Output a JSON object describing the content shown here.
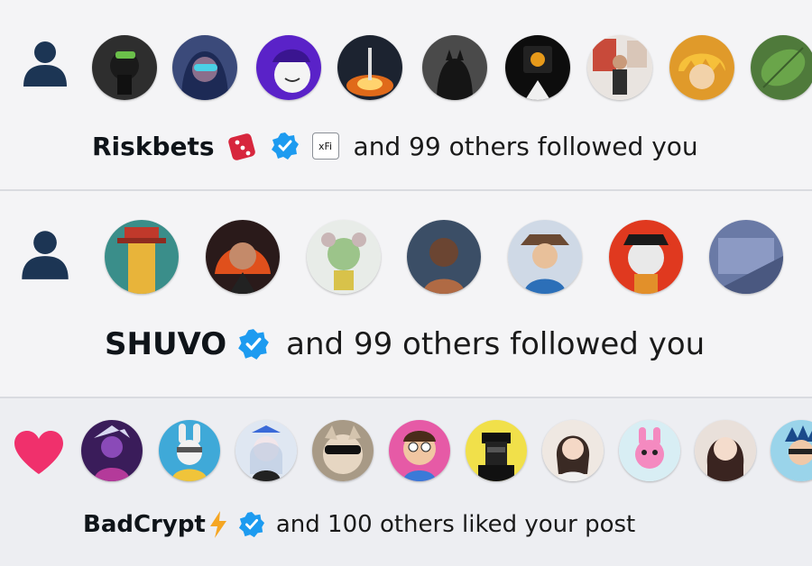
{
  "notifications": [
    {
      "type": "follow",
      "name": "Riskbets",
      "badges": [
        "dice-icon",
        "verified-badge-icon",
        "xfi-badge"
      ],
      "xfi_label": "xFi",
      "message": "and 99 others followed you",
      "avatar_count": 9
    },
    {
      "type": "follow",
      "name": "SHUVO",
      "badges": [
        "verified-badge-icon"
      ],
      "message": "and 99 others followed you",
      "avatar_count": 7
    },
    {
      "type": "like",
      "name": "BadCrypt",
      "badges": [
        "lightning-icon",
        "verified-badge-icon"
      ],
      "message": "and 100 others liked your post",
      "avatar_count": 10
    }
  ],
  "colors": {
    "person_icon": "#1c3554",
    "heart": "#f0306c",
    "verified": "#1d9bf0",
    "dice": "#d7263d",
    "lightning": "#f5a623"
  }
}
